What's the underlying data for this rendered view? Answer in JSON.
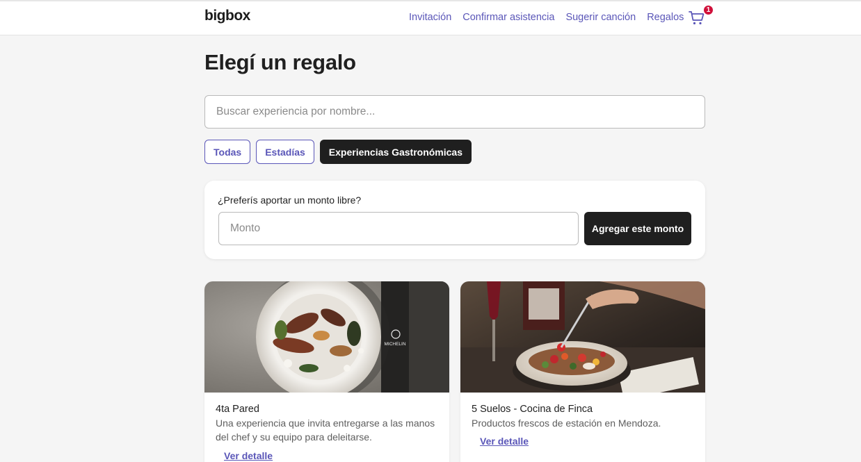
{
  "header": {
    "logo": "bigbox",
    "nav": [
      "Invitación",
      "Confirmar asistencia",
      "Sugerir canción",
      "Regalos"
    ],
    "cart_count": "1"
  },
  "page": {
    "title": "Elegí un regalo",
    "search_placeholder": "Buscar experiencia por nombre...",
    "filters": [
      "Todas",
      "Estadías",
      "Experiencias Gastronómicas"
    ],
    "active_filter": "Experiencias Gastronómicas"
  },
  "amount": {
    "label": "¿Preferís aportar un monto libre?",
    "placeholder": "Monto",
    "button": "Agregar este monto"
  },
  "cards": [
    {
      "title": "4ta Pared",
      "description": "Una experiencia que invita entregarse a las manos del chef y su equipo para deleitarse.",
      "link": "Ver detalle",
      "image_badge": "MICHELIN"
    },
    {
      "title": "5 Suelos - Cocina de Finca",
      "description": "Productos frescos de estación en Mendoza.",
      "link": "Ver detalle"
    }
  ],
  "colors": {
    "accent": "#5a56b8",
    "dark": "#1f1f1f",
    "badge": "#d0103a",
    "background": "#f5f5f5"
  }
}
